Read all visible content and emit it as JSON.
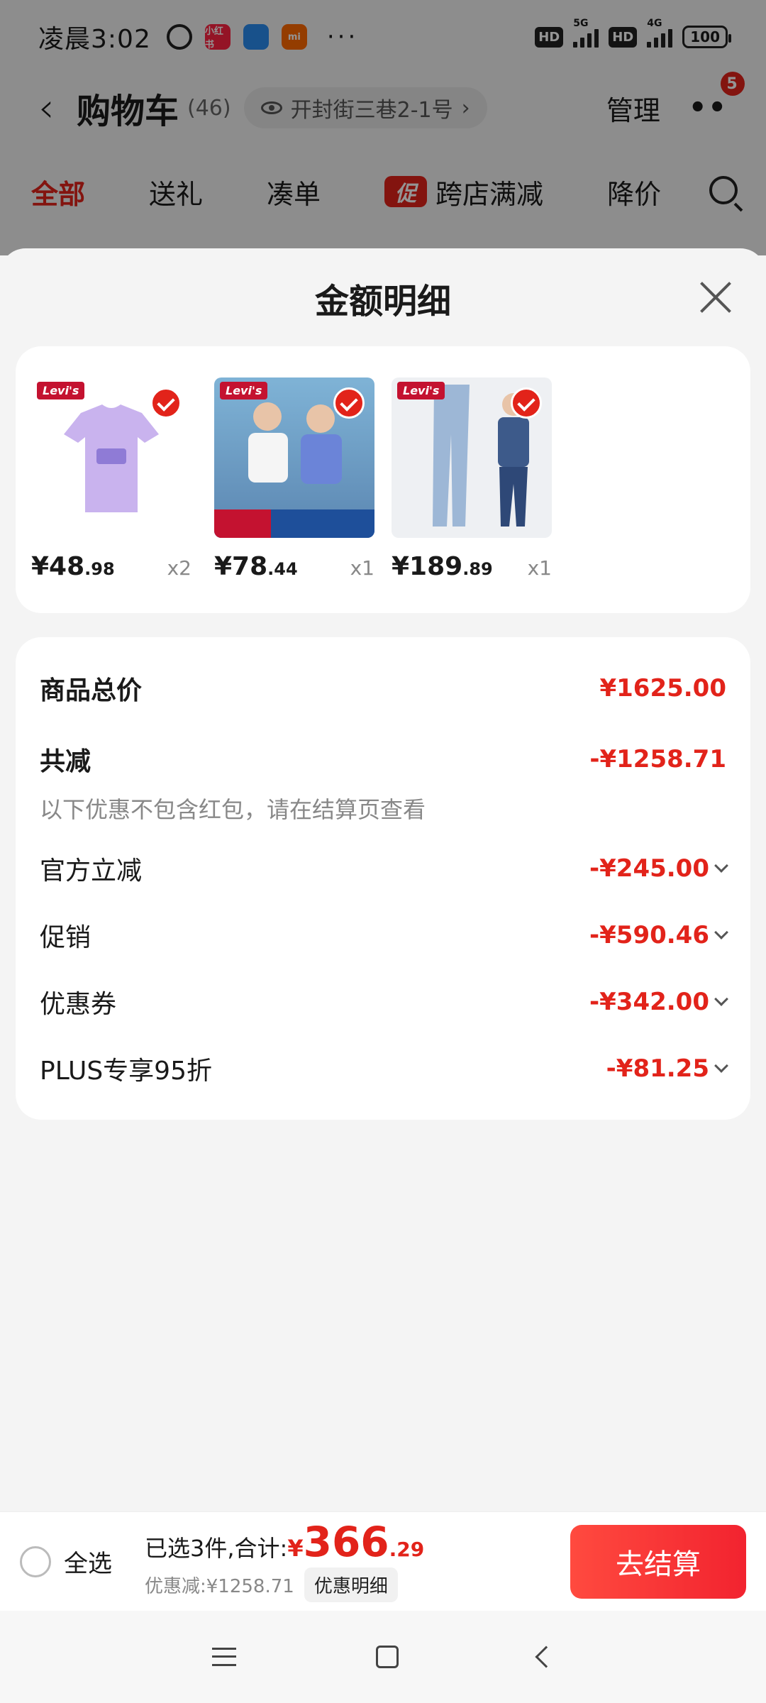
{
  "status_bar": {
    "time": "凌晨3:02",
    "app_icons": [
      "小红书",
      "layers",
      "mi"
    ],
    "more": "···",
    "signal_1": "5G",
    "signal_2": "4G",
    "battery": "100",
    "hd_label": "HD"
  },
  "nav": {
    "title": "购物车",
    "count": "(46)",
    "address": "开封街三巷2-1号",
    "manage_label": "管理",
    "more_badge": "5"
  },
  "tabs": [
    {
      "label": "全部",
      "active": true
    },
    {
      "label": "送礼"
    },
    {
      "label": "凑单"
    },
    {
      "label": "跨店满减",
      "tag": "促"
    },
    {
      "label": "降价"
    }
  ],
  "sheet": {
    "title": "金额明细",
    "products": [
      {
        "price_int": "¥48",
        "price_dec": ".98",
        "qty": "x2",
        "brand": "Levi's"
      },
      {
        "price_int": "¥78",
        "price_dec": ".44",
        "qty": "x1",
        "brand": "Levi's"
      },
      {
        "price_int": "¥189",
        "price_dec": ".89",
        "qty": "x1",
        "brand": "Levi's"
      }
    ],
    "summary": {
      "total_label": "商品总价",
      "total_value": "¥1625.00",
      "discount_label": "共减",
      "discount_value": "-¥1258.71",
      "note": "以下优惠不包含红包，请在结算页查看",
      "items": [
        {
          "label": "官方立减",
          "value": "-¥245.00"
        },
        {
          "label": "促销",
          "value": "-¥590.46"
        },
        {
          "label": "优惠券",
          "value": "-¥342.00"
        },
        {
          "label": "PLUS专享95折",
          "value": "-¥81.25"
        }
      ]
    }
  },
  "bottom": {
    "select_all": "全选",
    "selected_text": "已选3件,合计:",
    "total_yen": "¥",
    "total_int": "366",
    "total_dec": ".29",
    "saved_text": "优惠减:¥1258.71",
    "detail_label": "优惠明细",
    "checkout_label": "去结算"
  },
  "colors": {
    "accent": "#e2231a",
    "brand_red": "#c41230"
  }
}
